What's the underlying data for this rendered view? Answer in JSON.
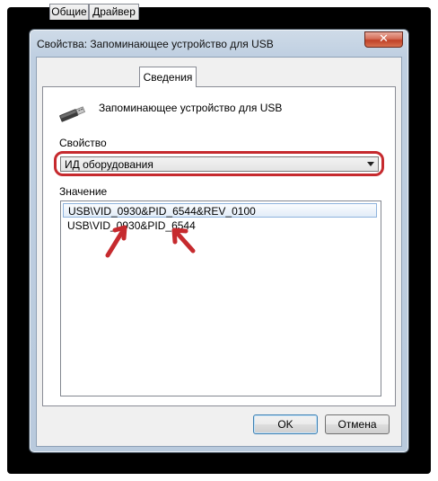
{
  "window": {
    "title": "Свойства: Запоминающее устройство для USB",
    "close_glyph": "✕"
  },
  "tabs": [
    {
      "label": "Общие"
    },
    {
      "label": "Драйвер"
    },
    {
      "label": "Сведения"
    }
  ],
  "device": {
    "icon": "usb-device-icon",
    "name": "Запоминающее устройство для USB"
  },
  "property": {
    "label": "Свойство",
    "selected": "ИД оборудования",
    "highlight_color": "#c62a2e"
  },
  "values": {
    "label": "Значение",
    "items": [
      "USB\\VID_0930&PID_6544&REV_0100",
      "USB\\VID_0930&PID_6544"
    ]
  },
  "buttons": {
    "ok": "OK",
    "cancel": "Отмена"
  },
  "annotation_color": "#c62a2e"
}
